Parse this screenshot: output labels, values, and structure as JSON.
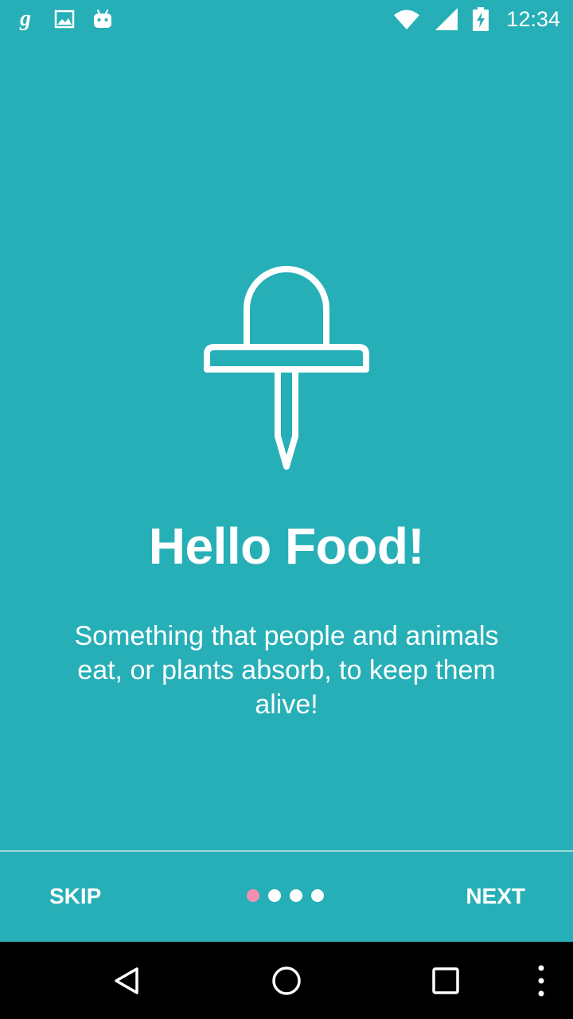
{
  "status_bar": {
    "time": "12:34",
    "left_icons": [
      "goodreads-icon",
      "image-icon",
      "android-icon"
    ],
    "right_icons": [
      "wifi-icon",
      "signal-icon",
      "battery-charging-icon"
    ]
  },
  "onboarding": {
    "icon": "pushpin-icon",
    "title": "Hello Food!",
    "description": "Something that people and animals eat, or plants absorb, to keep them alive!",
    "page_index": 1,
    "page_count": 4
  },
  "footer": {
    "skip_label": "SKIP",
    "next_label": "NEXT"
  },
  "navigation": {
    "buttons": [
      "back-icon",
      "home-icon",
      "recents-icon",
      "more-icon"
    ]
  },
  "colors": {
    "background": "#27AFB7",
    "active_dot": "#F48FB1",
    "inactive_dot": "#FFFFFF",
    "nav_bar": "#000000"
  }
}
